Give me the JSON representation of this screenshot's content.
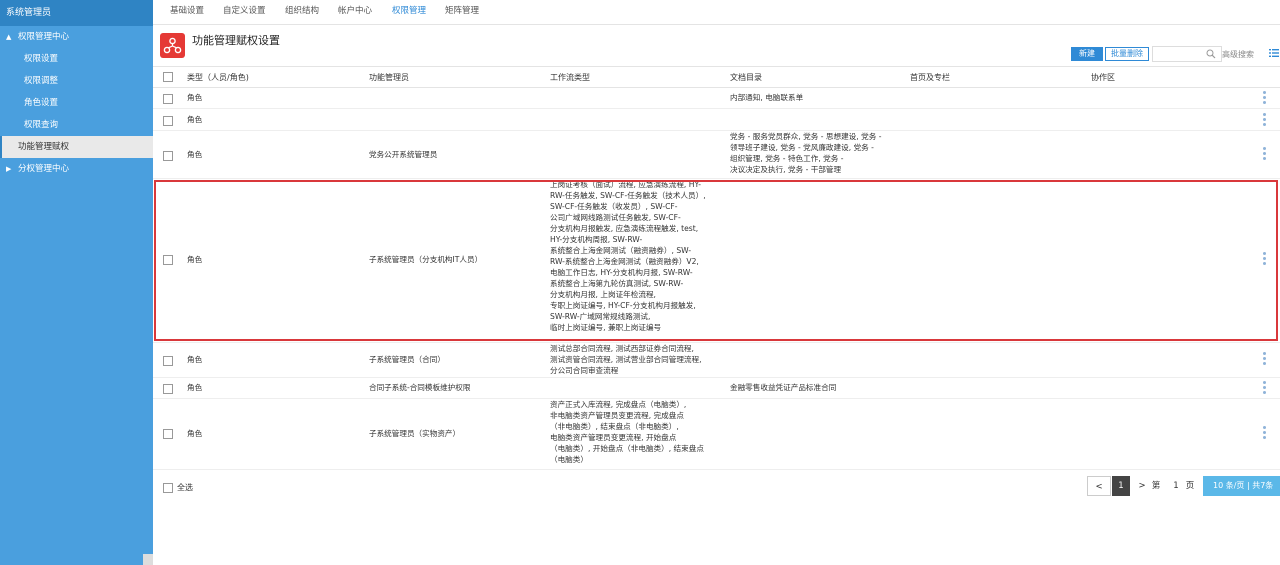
{
  "sidebar": {
    "title": "系统管理员",
    "items": [
      {
        "label": "权限管理中心",
        "arrow": "▲"
      },
      {
        "label": "权限设置"
      },
      {
        "label": "权限调整"
      },
      {
        "label": "角色设置"
      },
      {
        "label": "权限查询"
      },
      {
        "label": "功能管理赋权"
      },
      {
        "label": "分权管理中心",
        "arrow": "▶"
      }
    ]
  },
  "tabs": [
    "基础设置",
    "自定义设置",
    "组织结构",
    "帐户中心",
    "权限管理",
    "矩阵管理"
  ],
  "page": {
    "title": "功能管理赋权设置"
  },
  "toolbar": {
    "new": "新建",
    "bulk_delete": "批量删除",
    "search_placeholder": "",
    "advanced": "高级搜索"
  },
  "columns": [
    "类型（人员/角色)",
    "功能管理员",
    "工作流类型",
    "文档目录",
    "首页及专栏",
    "协作区"
  ],
  "rows": [
    {
      "type": "角色",
      "admin": "",
      "workflow": "",
      "docs": "内部通知, 电脑联系单"
    },
    {
      "type": "角色",
      "admin": "",
      "workflow": "",
      "docs": ""
    },
    {
      "type": "角色",
      "admin": "党务公开系统管理员",
      "workflow": "",
      "docs": "党务 - 服务党员群众, 党务 - 思想建设, 党务 -\n领导班子建设, 党务 - 党风廉政建设, 党务 -\n组织管理, 党务 - 特色工作, 党务 -\n决议决定及执行, 党务 - 干部管理"
    },
    {
      "type": "角色",
      "admin": "子系统管理员（分支机构IT人员）",
      "workflow": "上岗证考核（面试）流程, 应急演练流程, HY-\nRW-任务触发, SW-CF-任务触发（技术人员）,\nSW-CF-任务触发（收发员）, SW-CF-\n公司广域网线路测试任务触发, SW-CF-\n分支机构月报触发, 应急演练流程触发, test,\nHY-分支机构周报, SW-RW-\n系统整合上海金网测试（融资融券）, SW-\nRW-系统整合上海金网测试（融资融券）V2,\n电脑工作日志, HY-分支机构月报, SW-RW-\n系统整合上海第九轮仿真测试, SW-RW-\n分支机构月报, 上岗证年检流程,\n专职上岗证编号, HY-CF-分支机构月报触发,\nSW-RW-广域网常规线路测试,\n临时上岗证编号, 兼职上岗证编号",
      "docs": ""
    },
    {
      "type": "角色",
      "admin": "子系统管理员（合同）",
      "workflow": "测试总部合同流程, 测试西部证券合同流程,\n测试资管合同流程, 测试营业部合同管理流程,\n分公司合同审查流程",
      "docs": ""
    },
    {
      "type": "角色",
      "admin": "合同子系统-合同模板维护权限",
      "workflow": "",
      "docs": "金融零售收益凭证产品标准合同"
    },
    {
      "type": "角色",
      "admin": "子系统管理员（实物资产）",
      "workflow": "资产正式入库流程, 完成盘点（电脑类）,\n非电脑类资产管理员变更流程, 完成盘点\n（非电脑类）, 结束盘点（非电脑类）,\n电脑类资产管理员变更流程, 开始盘点\n（电脑类）, 开始盘点（非电脑类）, 结束盘点\n（电脑类）",
      "docs": ""
    }
  ],
  "footer": {
    "select_all": "全选",
    "prev": "<",
    "current_page": "1",
    "next": ">",
    "page_prefix": "第",
    "page_input": "1",
    "page_suffix": "页",
    "page_size": "10   条/页 | 共7条"
  },
  "colors": {
    "sidebar": "#4a9fde",
    "accent": "#2f8ad6",
    "highlight": "#d9383b",
    "page_icon": "#e53935"
  }
}
